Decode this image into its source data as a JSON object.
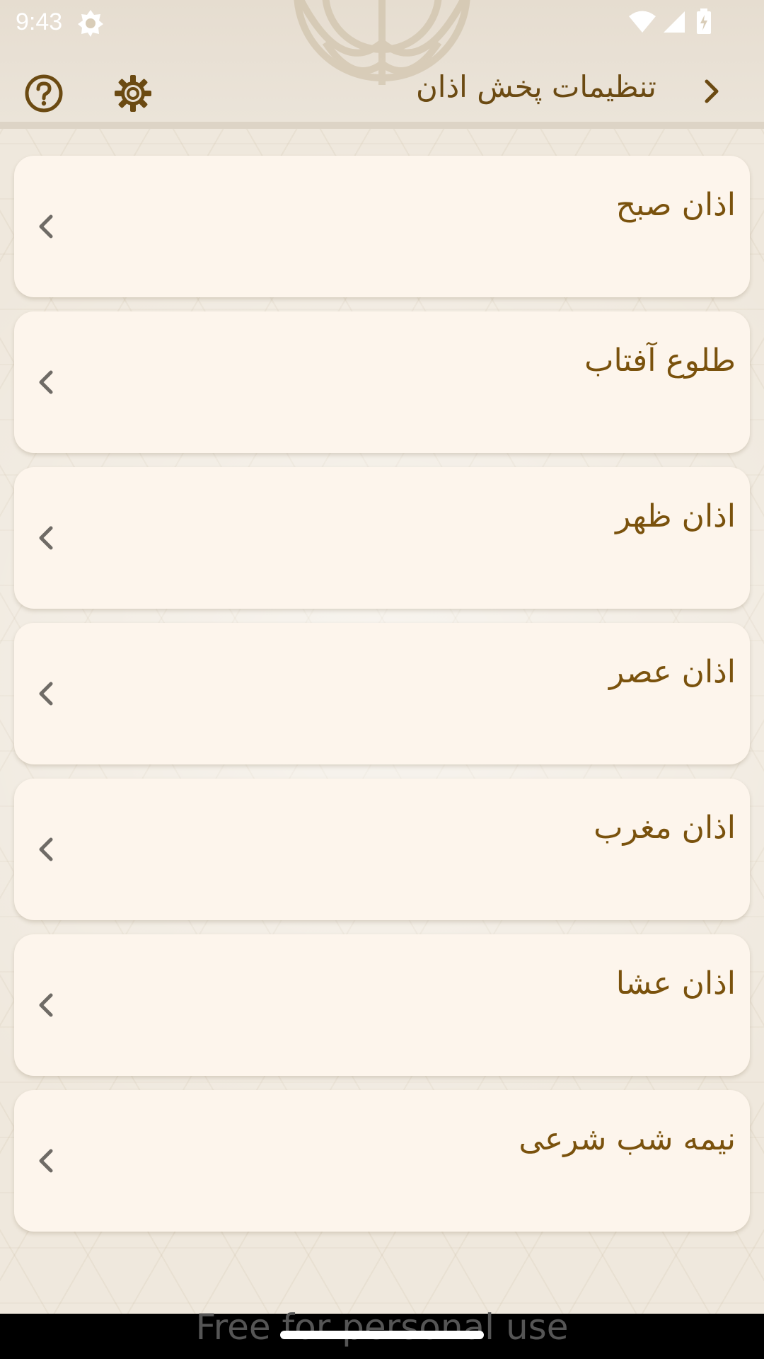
{
  "status_bar": {
    "time": "9:43",
    "app_icon": "notification-badge-icon",
    "wifi_icon": "wifi-icon",
    "signal_icon": "cell-signal-icon",
    "battery_icon": "battery-charging-icon"
  },
  "toolbar": {
    "title": "تنظیمات پخش اذان",
    "back_icon": "chevron-right-icon",
    "help_icon": "help-circle-icon",
    "settings_icon": "gear-icon"
  },
  "items": [
    {
      "label": "اذان صبح"
    },
    {
      "label": "طلوع آفتاب"
    },
    {
      "label": "اذان ظهر"
    },
    {
      "label": "اذان عصر"
    },
    {
      "label": "اذان مغرب"
    },
    {
      "label": "اذان عشا"
    },
    {
      "label": "نیمه شب شرعی"
    }
  ],
  "item_icon": "chevron-left-icon",
  "nav": {
    "watermark": "Free for personal use"
  },
  "colors": {
    "accent": "#6b4a12",
    "card_bg": "#fdf5ec",
    "page_bg": "#efe8dd"
  }
}
